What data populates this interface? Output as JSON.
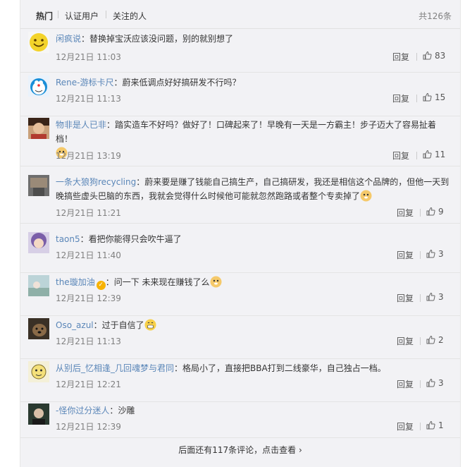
{
  "tabs": {
    "hot": "热门",
    "verified": "认证用户",
    "following": "关注的人",
    "total": "共126条"
  },
  "reply_label": "回复",
  "comments": [
    {
      "user": "闲疯说",
      "text": "替换掉宝沃应该没问题，别的就别想了",
      "time": "12月21日 11:03",
      "likes": "83",
      "avatar": "smiley-avatar"
    },
    {
      "user": "Rene-游标卡尺",
      "text": "蔚来低调点好好搞研发不行吗？",
      "time": "12月21日 11:13",
      "likes": "15",
      "avatar": "robot-cat-avatar"
    },
    {
      "user": "物非是人已非",
      "text": "踏实造车不好吗？做好了！口碑起来了！早晚有一天是一方霸主！步子迈大了容易扯着档！",
      "time": "12月21日 13:19",
      "likes": "11",
      "avatar": "person-avatar"
    },
    {
      "user": "一条大狼狗recycling",
      "text": "蔚来要是赚了钱能自己搞生产，自己搞研发，我还是相信这个品牌的，但他一天到晚搞些虚头巴脑的东西，我就会觉得什么时候他可能就忽然跑路或者整个专卖掉了",
      "time": "12月21日 11:21",
      "likes": "9",
      "avatar": "photo-avatar"
    },
    {
      "user": "taon5",
      "text": "看把你能得只会吹牛逼了",
      "time": "12月21日 11:40",
      "likes": "3",
      "avatar": "girl-avatar"
    },
    {
      "user": "the璇加油",
      "text": "问一下 未来现在赚钱了么",
      "time": "12月21日 12:39",
      "likes": "3",
      "avatar": "scene-avatar"
    },
    {
      "user": "Oso_azul",
      "text": "过于自信了",
      "time": "12月21日 11:13",
      "likes": "2",
      "avatar": "dog-avatar"
    },
    {
      "user": "从别后_忆相逢_几回魂梦与君同",
      "text": "格局小了，直接把BBA打到二线豪华，自己独占一档。",
      "time": "12月21日 12:21",
      "likes": "3",
      "avatar": "cartoon-avatar"
    },
    {
      "user": "-怪你过分迷人",
      "text": "沙雕",
      "time": "12月21日 12:39",
      "likes": "1",
      "avatar": "dark-avatar"
    }
  ],
  "footer": {
    "more": "后面还有117条评论，点击查看"
  },
  "colors": {
    "username": "#5a86b8",
    "background": "#f2f2f5",
    "badge": "#f7b200"
  }
}
